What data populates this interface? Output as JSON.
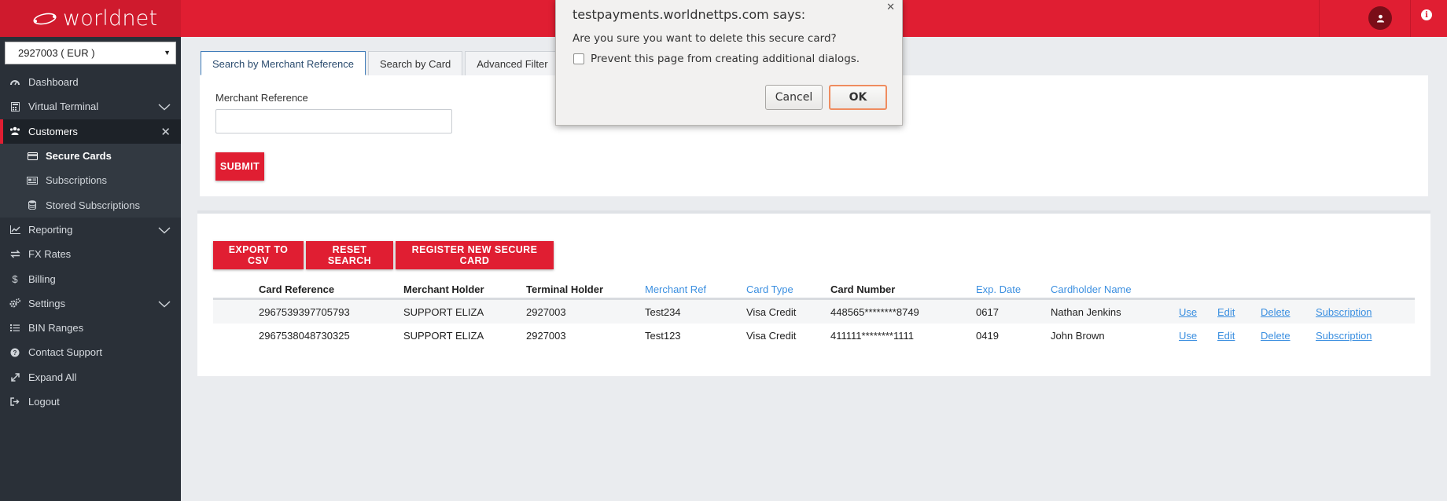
{
  "header": {
    "brand": "worldnet"
  },
  "sidebar": {
    "merchant_select": "2927003 ( EUR )",
    "items": [
      {
        "label": "Dashboard",
        "icon": "dashboard-icon"
      },
      {
        "label": "Virtual Terminal",
        "icon": "calculator-icon"
      },
      {
        "label": "Customers",
        "icon": "users-icon"
      },
      {
        "label": "Reporting",
        "icon": "chart-icon"
      },
      {
        "label": "FX Rates",
        "icon": "exchange-icon"
      },
      {
        "label": "Billing",
        "icon": "dollar-icon"
      },
      {
        "label": "Settings",
        "icon": "gears-icon"
      },
      {
        "label": "BIN Ranges",
        "icon": "list-icon"
      },
      {
        "label": "Contact Support",
        "icon": "question-icon"
      },
      {
        "label": "Expand All",
        "icon": "expand-icon"
      },
      {
        "label": "Logout",
        "icon": "logout-icon"
      }
    ],
    "customers_sub": [
      {
        "label": "Secure Cards",
        "icon": "credit-card-icon"
      },
      {
        "label": "Subscriptions",
        "icon": "newspaper-icon"
      },
      {
        "label": "Stored Subscriptions",
        "icon": "database-icon"
      }
    ]
  },
  "search": {
    "tabs": [
      "Search by Merchant Reference",
      "Search by Card",
      "Advanced Filter"
    ],
    "field_label": "Merchant Reference",
    "field_value": "",
    "submit_label": "SUBMIT"
  },
  "results": {
    "toolbar": [
      "EXPORT TO CSV",
      "RESET SEARCH",
      "REGISTER NEW SECURE CARD"
    ],
    "columns": [
      "Card Reference",
      "Merchant Holder",
      "Terminal Holder",
      "Merchant Ref",
      "Card Type",
      "Card Number",
      "Exp. Date",
      "Cardholder Name"
    ],
    "rows": [
      {
        "card_ref": "2967539397705793",
        "merchant_holder": "SUPPORT ELIZA",
        "terminal_holder": "2927003",
        "merchant_ref": "Test234",
        "card_type": "Visa Credit",
        "card_number": "448565********8749",
        "exp": "0617",
        "name": "Nathan Jenkins"
      },
      {
        "card_ref": "2967538048730325",
        "merchant_holder": "SUPPORT ELIZA",
        "terminal_holder": "2927003",
        "merchant_ref": "Test123",
        "card_type": "Visa Credit",
        "card_number": "411111********1111",
        "exp": "0419",
        "name": "John Brown"
      }
    ],
    "actions": [
      "Use",
      "Edit",
      "Delete",
      "Subscription"
    ]
  },
  "dialog": {
    "title": "testpayments.worldnettps.com says:",
    "message": "Are you sure you want to delete this secure card?",
    "checkbox_label": "Prevent this page from creating additional dialogs.",
    "cancel_label": "Cancel",
    "ok_label": "OK"
  },
  "colors": {
    "brand_red": "#e01e32",
    "sidebar_bg": "#2a3038",
    "link_blue": "#3b8fe0"
  }
}
